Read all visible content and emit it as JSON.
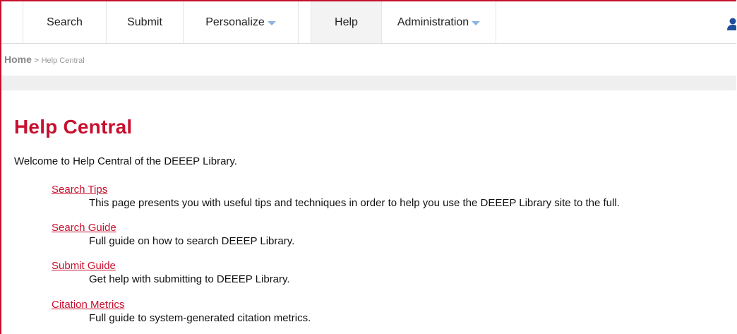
{
  "nav": {
    "tabs": [
      {
        "label": "Search",
        "dropdown": false,
        "active": false
      },
      {
        "label": "Submit",
        "dropdown": false,
        "active": false
      },
      {
        "label": "Personalize",
        "dropdown": true,
        "active": false
      },
      {
        "label": "Help",
        "dropdown": false,
        "active": true
      },
      {
        "label": "Administration",
        "dropdown": true,
        "active": false
      }
    ],
    "user_icon": "user-icon"
  },
  "breadcrumb": {
    "home": "Home",
    "separator": ">",
    "current": "Help Central"
  },
  "page": {
    "title": "Help Central",
    "intro": "Welcome to Help Central of the DEEEP Library.",
    "items": [
      {
        "link": "Search Tips",
        "desc": "This page presents you with useful tips and techniques in order to help you use the DEEEP Library site to the full."
      },
      {
        "link": "Search Guide",
        "desc": "Full guide on how to search DEEEP Library."
      },
      {
        "link": "Submit Guide",
        "desc": "Get help with submitting to DEEEP Library."
      },
      {
        "link": "Citation Metrics",
        "desc": "Full guide to system-generated citation metrics."
      }
    ]
  },
  "colors": {
    "accent": "#c8102e",
    "dropdown_caret": "#8ab4e0",
    "user_icon": "#1f4e9c"
  }
}
